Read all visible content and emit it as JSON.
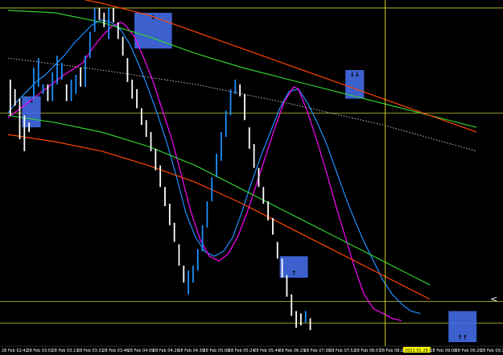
{
  "chart_data": {
    "type": "candlestick",
    "background": "#000000",
    "x_ticks": [
      "28 Feb 02:42",
      "28 Feb 03:01",
      "28 Feb 03:13",
      "28 Feb 03:31",
      "28 Feb 03:46",
      "28 Feb 04:09",
      "28 Feb 04:26",
      "28 Feb 04:39",
      "28 Feb 05:08",
      "28 Feb 05:24",
      "28 Feb 05:44",
      "28 Feb 06:29",
      "28 Feb 07:36",
      "28 Feb 07:52",
      "28 Feb 08:07",
      "28 Feb 08:21",
      "2022.02.28 08:47",
      "28 Feb 09:08",
      "28 Feb 09:20",
      "28 Feb 09:26"
    ],
    "cursor_label": "2022.02.28 08:47",
    "price_level_marker": "<",
    "colors": {
      "bull_bar": "#1e90ff",
      "bear_bar": "#ffffff",
      "signal_box": "#4169e1",
      "fast_ma": "#1e90ff",
      "signal_ma": "#ff00ff",
      "slow_ma_green": "#32cd32",
      "slow_ma_red": "#ff4500",
      "dotted_ma": "#c0c0c0",
      "level_lines": "#c8c832",
      "cursor_line": "#ffff00"
    },
    "bars": [
      {
        "x": 0,
        "o": 190,
        "c": 175
      },
      {
        "x": 1,
        "o": 186,
        "c": 179
      },
      {
        "x": 2,
        "o": 182,
        "c": 165
      },
      {
        "x": 3,
        "o": 175,
        "c": 160
      },
      {
        "x": 4,
        "o": 172,
        "c": 168
      },
      {
        "x": 5,
        "o": 182,
        "c": 195
      },
      {
        "x": 6,
        "o": 187,
        "c": 199
      },
      {
        "x": 7,
        "o": 184,
        "c": 188
      },
      {
        "x": 8,
        "o": 188,
        "c": 181
      },
      {
        "x": 9,
        "o": 181,
        "c": 193
      },
      {
        "x": 10,
        "o": 188,
        "c": 200
      },
      {
        "x": 11,
        "o": 190,
        "c": 197
      },
      {
        "x": 12,
        "o": 188,
        "c": 181
      },
      {
        "x": 13,
        "o": 181,
        "c": 190
      },
      {
        "x": 14,
        "o": 184,
        "c": 192
      },
      {
        "x": 15,
        "o": 195,
        "c": 187
      },
      {
        "x": 16,
        "o": 187,
        "c": 200
      },
      {
        "x": 17,
        "o": 199,
        "c": 210
      },
      {
        "x": 18,
        "o": 210,
        "c": 220
      },
      {
        "x": 19,
        "o": 220,
        "c": 215
      },
      {
        "x": 20,
        "o": 218,
        "c": 212
      },
      {
        "x": 21,
        "o": 207,
        "c": 220
      },
      {
        "x": 22,
        "o": 220,
        "c": 214
      },
      {
        "x": 23,
        "o": 214,
        "c": 207
      },
      {
        "x": 24,
        "o": 208,
        "c": 200
      },
      {
        "x": 25,
        "o": 199,
        "c": 189
      },
      {
        "x": 26,
        "o": 190,
        "c": 182
      },
      {
        "x": 27,
        "o": 186,
        "c": 178
      },
      {
        "x": 28,
        "o": 178,
        "c": 171
      },
      {
        "x": 29,
        "o": 173,
        "c": 166
      },
      {
        "x": 30,
        "o": 168,
        "c": 160
      },
      {
        "x": 31,
        "o": 161,
        "c": 152
      },
      {
        "x": 32,
        "o": 154,
        "c": 145
      },
      {
        "x": 33,
        "o": 145,
        "c": 137
      },
      {
        "x": 34,
        "o": 138,
        "c": 129
      },
      {
        "x": 35,
        "o": 130,
        "c": 122
      },
      {
        "x": 36,
        "o": 121,
        "c": 112
      },
      {
        "x": 37,
        "o": 112,
        "c": 105
      },
      {
        "x": 38,
        "o": 100,
        "c": 110
      },
      {
        "x": 39,
        "o": 105,
        "c": 112
      },
      {
        "x": 40,
        "o": 110,
        "c": 119
      },
      {
        "x": 41,
        "o": 118,
        "c": 129
      },
      {
        "x": 42,
        "o": 128,
        "c": 139
      },
      {
        "x": 43,
        "o": 139,
        "c": 149
      },
      {
        "x": 44,
        "o": 149,
        "c": 159
      },
      {
        "x": 45,
        "o": 156,
        "c": 168
      },
      {
        "x": 46,
        "o": 166,
        "c": 177
      },
      {
        "x": 47,
        "o": 175,
        "c": 186
      },
      {
        "x": 48,
        "o": 184,
        "c": 190
      },
      {
        "x": 49,
        "o": 188,
        "c": 183
      },
      {
        "x": 50,
        "o": 184,
        "c": 173
      },
      {
        "x": 51,
        "o": 170,
        "c": 161
      },
      {
        "x": 52,
        "o": 163,
        "c": 153
      },
      {
        "x": 53,
        "o": 153,
        "c": 145
      },
      {
        "x": 54,
        "o": 145,
        "c": 138
      },
      {
        "x": 55,
        "o": 139,
        "c": 131
      },
      {
        "x": 56,
        "o": 132,
        "c": 125
      },
      {
        "x": 57,
        "o": 122,
        "c": 115
      },
      {
        "x": 58,
        "o": 115,
        "c": 107
      },
      {
        "x": 59,
        "o": 108,
        "c": 99
      },
      {
        "x": 60,
        "o": 100,
        "c": 91
      },
      {
        "x": 61,
        "o": 93,
        "c": 86
      },
      {
        "x": 62,
        "o": 92,
        "c": 87
      },
      {
        "x": 63,
        "o": 88,
        "c": 93
      },
      {
        "x": 64,
        "o": 90,
        "c": 85
      }
    ],
    "moving_averages": [
      {
        "key": "fast",
        "style": "solid",
        "points": [
          [
            0,
            176
          ],
          [
            2,
            181
          ],
          [
            4,
            185
          ],
          [
            6,
            189
          ],
          [
            8,
            192
          ],
          [
            10,
            196
          ],
          [
            12,
            200
          ],
          [
            14,
            205
          ],
          [
            16,
            209
          ],
          [
            18,
            213
          ],
          [
            20,
            215
          ],
          [
            22,
            214
          ],
          [
            24,
            211
          ],
          [
            26,
            205
          ],
          [
            28,
            196
          ],
          [
            30,
            186
          ],
          [
            32,
            175
          ],
          [
            34,
            163
          ],
          [
            36,
            149
          ],
          [
            38,
            134
          ],
          [
            40,
            124
          ],
          [
            42,
            118
          ],
          [
            44,
            116
          ],
          [
            46,
            118
          ],
          [
            48,
            124
          ],
          [
            50,
            135
          ],
          [
            52,
            147
          ],
          [
            54,
            158
          ],
          [
            56,
            168
          ],
          [
            58,
            178
          ],
          [
            60,
            185
          ],
          [
            62,
            186
          ],
          [
            64,
            180
          ],
          [
            66,
            172
          ],
          [
            68,
            163
          ],
          [
            70,
            152
          ],
          [
            72,
            141
          ],
          [
            74,
            131
          ],
          [
            76,
            122
          ],
          [
            78,
            114
          ],
          [
            80,
            106
          ],
          [
            82,
            100
          ],
          [
            84,
            96
          ],
          [
            86,
            93
          ],
          [
            88,
            92
          ]
        ]
      },
      {
        "key": "signal",
        "style": "solid",
        "points": [
          [
            0,
            174
          ],
          [
            4,
            180
          ],
          [
            8,
            186
          ],
          [
            12,
            192
          ],
          [
            16,
            197
          ],
          [
            18,
            203
          ],
          [
            20,
            208
          ],
          [
            22,
            212
          ],
          [
            24,
            214
          ],
          [
            25,
            213
          ],
          [
            27,
            208
          ],
          [
            29,
            199
          ],
          [
            31,
            189
          ],
          [
            33,
            177
          ],
          [
            35,
            165
          ],
          [
            37,
            150
          ],
          [
            39,
            135
          ],
          [
            41,
            123
          ],
          [
            43,
            116
          ],
          [
            45,
            114
          ],
          [
            47,
            117
          ],
          [
            49,
            124
          ],
          [
            51,
            134
          ],
          [
            53,
            146
          ],
          [
            55,
            158
          ],
          [
            57,
            170
          ],
          [
            59,
            181
          ],
          [
            61,
            187
          ],
          [
            62,
            186
          ],
          [
            64,
            176
          ],
          [
            66,
            164
          ],
          [
            68,
            151
          ],
          [
            70,
            137
          ],
          [
            72,
            124
          ],
          [
            74,
            111
          ],
          [
            76,
            100
          ],
          [
            78,
            94
          ],
          [
            80,
            92
          ],
          [
            82,
            90
          ],
          [
            84,
            89
          ]
        ]
      },
      {
        "key": "slow_green_upper",
        "style": "solid",
        "points": [
          [
            0,
            219
          ],
          [
            10,
            218
          ],
          [
            20,
            214
          ],
          [
            30,
            208
          ],
          [
            40,
            201
          ],
          [
            50,
            195
          ],
          [
            60,
            190
          ],
          [
            70,
            185
          ],
          [
            80,
            180
          ],
          [
            90,
            175
          ],
          [
            100,
            170
          ]
        ]
      },
      {
        "key": "slow_red_upper",
        "style": "solid",
        "points": [
          [
            0,
            229
          ],
          [
            10,
            226
          ],
          [
            20,
            222
          ],
          [
            30,
            217
          ],
          [
            40,
            210
          ],
          [
            50,
            203
          ],
          [
            60,
            196
          ],
          [
            70,
            189
          ],
          [
            80,
            182
          ],
          [
            90,
            175
          ],
          [
            100,
            168
          ]
        ]
      },
      {
        "key": "dotted",
        "style": "dotted",
        "points": [
          [
            0,
            199
          ],
          [
            20,
            194
          ],
          [
            40,
            188
          ],
          [
            60,
            180
          ],
          [
            80,
            171
          ],
          [
            100,
            160
          ]
        ]
      },
      {
        "key": "slow_green_lower",
        "style": "solid",
        "points": [
          [
            0,
            175
          ],
          [
            10,
            172
          ],
          [
            20,
            168
          ],
          [
            30,
            162
          ],
          [
            40,
            154
          ],
          [
            50,
            144
          ],
          [
            60,
            134
          ],
          [
            70,
            124
          ],
          [
            80,
            114
          ],
          [
            90,
            104
          ]
        ]
      },
      {
        "key": "slow_red_lower",
        "style": "solid",
        "points": [
          [
            0,
            167
          ],
          [
            10,
            164
          ],
          [
            20,
            160
          ],
          [
            30,
            154
          ],
          [
            40,
            147
          ],
          [
            50,
            138
          ],
          [
            60,
            128
          ],
          [
            70,
            118
          ],
          [
            80,
            108
          ],
          [
            90,
            98
          ]
        ]
      }
    ],
    "signal_boxes": [
      {
        "x_from": 3,
        "x_to": 7,
        "low": 170,
        "high": 183,
        "arrows": "down"
      },
      {
        "x_from": 27,
        "x_to": 35,
        "low": 203,
        "high": 218,
        "arrows": "down"
      },
      {
        "x_from": 58,
        "x_to": 64,
        "low": 107,
        "high": 116,
        "arrows": "up"
      },
      {
        "x_from": 72,
        "x_to": 76,
        "low": 182,
        "high": 194,
        "arrows": "down-down"
      },
      {
        "x_from": 94,
        "x_to": 100,
        "low": 80,
        "high": 93,
        "arrows": "up-up"
      }
    ],
    "level_lines": [
      220,
      176,
      97,
      88
    ],
    "cursor_x": 80,
    "ylim": [
      80,
      222
    ],
    "xlim": [
      -1,
      101
    ]
  }
}
